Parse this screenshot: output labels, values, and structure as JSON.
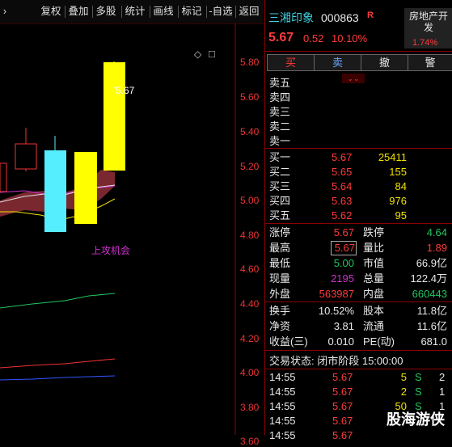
{
  "toolbar": {
    "items": [
      "复权",
      "叠加",
      "多股",
      "统计",
      "画线",
      "标记",
      "-自选",
      "返回"
    ]
  },
  "chart": {
    "y_ticks": [
      "5.80",
      "5.60",
      "5.40",
      "5.20",
      "5.00",
      "4.80",
      "4.60",
      "4.40",
      "4.20",
      "4.00",
      "3.80",
      "3.60"
    ],
    "peak_label": "5.67",
    "annotation": "上攻机会",
    "controls": {
      "diamond": "◇",
      "square": "□"
    }
  },
  "stock": {
    "name": "三湘印象",
    "code": "000863",
    "tag": "R",
    "price": "5.67",
    "change": "0.52",
    "pct": "10.10%",
    "sector": "房地产开发",
    "sector_pct": "1.74%"
  },
  "actions": {
    "buy": "买",
    "sell": "卖",
    "cancel": "撤",
    "alert": "警"
  },
  "sell_levels": [
    {
      "label": "卖五"
    },
    {
      "label": "卖四"
    },
    {
      "label": "卖三"
    },
    {
      "label": "卖二"
    },
    {
      "label": "卖一"
    }
  ],
  "buy_levels": [
    {
      "label": "买一",
      "price": "5.67",
      "vol": "25411"
    },
    {
      "label": "买二",
      "price": "5.65",
      "vol": "155"
    },
    {
      "label": "买三",
      "price": "5.64",
      "vol": "84"
    },
    {
      "label": "买四",
      "price": "5.63",
      "vol": "976"
    },
    {
      "label": "买五",
      "price": "5.62",
      "vol": "95"
    }
  ],
  "stats": {
    "zhangting_l": "涨停",
    "zhangting": "5.67",
    "dieting_l": "跌停",
    "dieting": "4.64",
    "zuigao_l": "最高",
    "zuigao": "5.67",
    "liangbi_l": "量比",
    "liangbi": "1.89",
    "zuidi_l": "最低",
    "zuidi": "5.00",
    "shizhi_l": "市值",
    "shizhi": "66.9亿",
    "xianliang_l": "现量",
    "xianliang": "2195",
    "zongliang_l": "总量",
    "zongliang": "122.4万",
    "waipan_l": "外盘",
    "waipan": "563987",
    "neipan_l": "内盘",
    "neipan": "660443",
    "huanshou_l": "换手",
    "huanshou": "10.52%",
    "guben_l": "股本",
    "guben": "11.8亿",
    "jingzi_l": "净资",
    "jingzi": "3.81",
    "liutong_l": "流通",
    "liutong": "11.6亿",
    "shouyi_l": "收益(三)",
    "shouyi": "0.010",
    "pe_l": "PE(动)",
    "pe": "681.0"
  },
  "status": "交易状态: 闭市阶段 15:00:00",
  "ticks": [
    {
      "time": "14:55",
      "price": "5.67",
      "vol": "5",
      "side": "S",
      "n": "2"
    },
    {
      "time": "14:55",
      "price": "5.67",
      "vol": "2",
      "side": "S",
      "n": "1"
    },
    {
      "time": "14:55",
      "price": "5.67",
      "vol": "50",
      "side": "S",
      "n": "1"
    },
    {
      "time": "14:55",
      "price": "5.67",
      "vol": "",
      "side": "",
      "n": ""
    },
    {
      "time": "14:55",
      "price": "5.67",
      "vol": "",
      "side": "",
      "n": ""
    }
  ],
  "watermark": "股海游侠"
}
